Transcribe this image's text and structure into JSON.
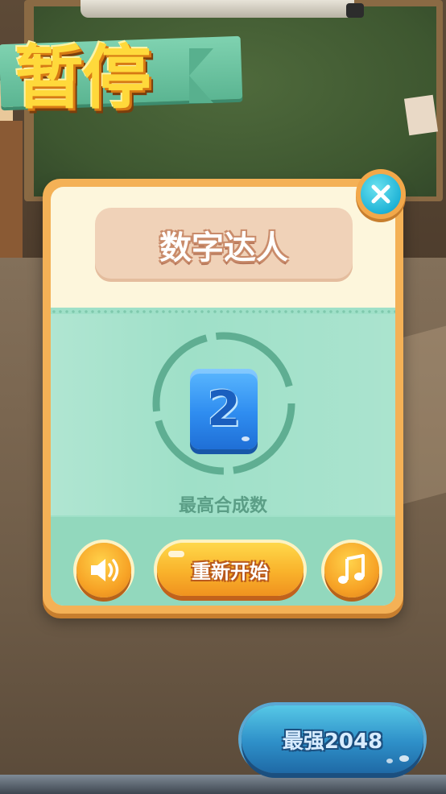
{
  "title": "暂停",
  "dialog": {
    "header": "数字达人",
    "tile_value": "2",
    "caption": "最高合成数",
    "restart_label": "重新开始"
  },
  "icons": {
    "close": "close-icon",
    "sound": "speaker-icon",
    "music": "music-note-icon"
  },
  "bottom_button": {
    "label": "最强2048"
  },
  "colors": {
    "accent_orange": "#f7a326",
    "panel_teal": "#9fe0c8",
    "tile_blue": "#2f8df0",
    "title_yellow": "#ffd93b"
  }
}
